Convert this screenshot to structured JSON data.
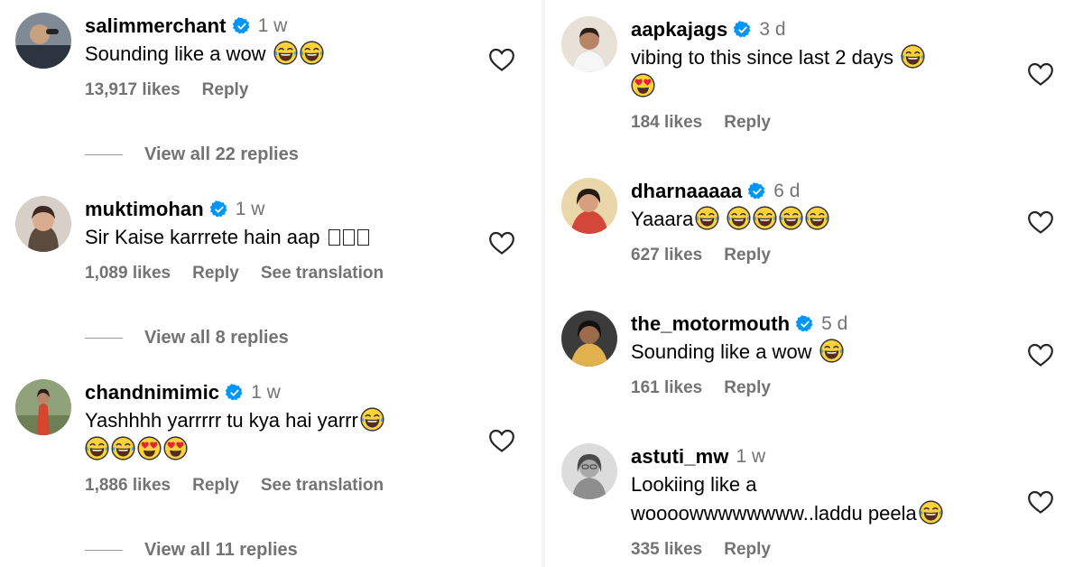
{
  "left": {
    "comments": [
      {
        "username": "salimmerchant",
        "time": "1 w",
        "text": "Sounding like a wow",
        "likes": "13,917 likes",
        "reply": "Reply",
        "view_replies": "View all 22 replies"
      },
      {
        "username": "muktimohan",
        "time": "1 w",
        "text": "Sir Kaise karrrete hain aap",
        "likes": "1,089 likes",
        "reply": "Reply",
        "translate": "See translation",
        "view_replies": "View all 8 replies"
      },
      {
        "username": "chandnimimic",
        "time": "1 w",
        "text": "Yashhhh yarrrrr tu kya hai yarrr",
        "likes": "1,886 likes",
        "reply": "Reply",
        "translate": "See translation",
        "view_replies": "View all 11 replies"
      }
    ]
  },
  "right": {
    "comments": [
      {
        "username": "aapkajags",
        "time": "3 d",
        "text": "vibing to this since last 2 days",
        "likes": "184 likes",
        "reply": "Reply"
      },
      {
        "username": "dharnaaaaa",
        "time": "6 d",
        "text": "Yaaara",
        "likes": "627 likes",
        "reply": "Reply"
      },
      {
        "username": "the_motormouth",
        "time": "5 d",
        "text": "Sounding like a wow",
        "likes": "161 likes",
        "reply": "Reply"
      },
      {
        "username": "astuti_mw",
        "time": "1 w",
        "text_line1": "Lookiing like a",
        "text_line2": "woooowwwwwwww..laddu peela",
        "likes": "335 likes",
        "reply": "Reply"
      }
    ]
  },
  "icons": {
    "verified": "verified-badge-icon",
    "like": "heart-outline-icon",
    "laugh": "face-with-tears-of-joy-emoji",
    "heart_eyes": "smiling-face-with-heart-eyes-emoji"
  },
  "colors": {
    "verified": "#0095f6",
    "secondary_text": "#737373",
    "primary_text": "#000000"
  }
}
